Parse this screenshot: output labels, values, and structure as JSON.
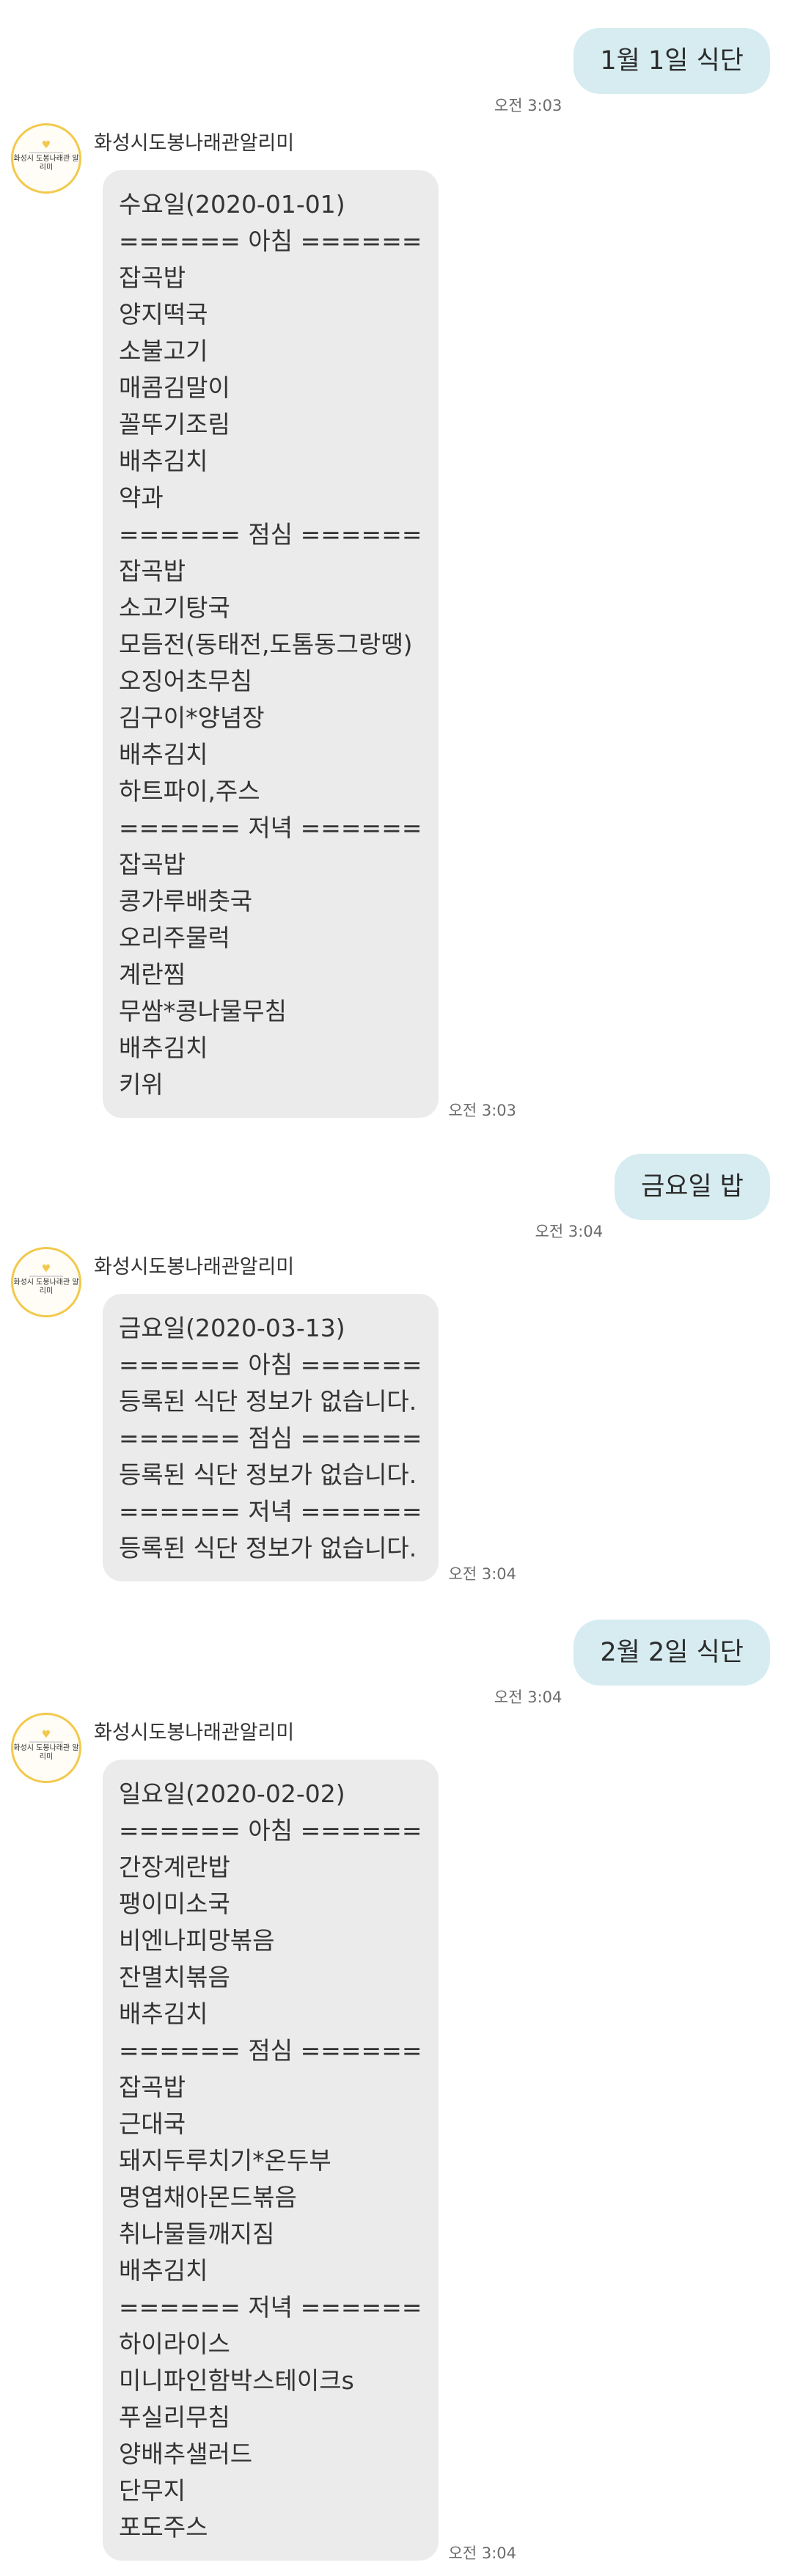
{
  "messages": [
    {
      "type": "out",
      "text": "1월 1일 식단",
      "time": "오전 3:03"
    },
    {
      "type": "in",
      "sender": "화성시도봉나래관알리미",
      "time": "오전 3:03",
      "lines": [
        "수요일(2020-01-01)",
        "====== 아침 ======",
        "잡곡밥",
        "양지떡국",
        "소불고기",
        "매콤김말이",
        "꼴뚜기조림",
        "배추김치",
        "약과",
        "====== 점심 ======",
        "잡곡밥",
        "소고기탕국",
        "모듬전(동태전,도톰동그랑땡)",
        "오징어초무침",
        "김구이*양념장",
        "배추김치",
        "하트파이,주스",
        "====== 저녁 ======",
        "잡곡밥",
        "콩가루배춧국",
        "오리주물럭",
        "계란찜",
        "무쌈*콩나물무침",
        "배추김치",
        "키위"
      ]
    },
    {
      "type": "out",
      "text": "금요일 밥",
      "time": "오전 3:04"
    },
    {
      "type": "in",
      "sender": "화성시도봉나래관알리미",
      "time": "오전 3:04",
      "lines": [
        "금요일(2020-03-13)",
        "====== 아침 ======",
        "등록된 식단 정보가 없습니다.",
        "====== 점심 ======",
        "등록된 식단 정보가 없습니다.",
        "====== 저녁 ======",
        "등록된 식단 정보가 없습니다."
      ]
    },
    {
      "type": "out",
      "text": "2월 2일 식단",
      "time": "오전 3:04"
    },
    {
      "type": "in",
      "sender": "화성시도봉나래관알리미",
      "time": "오전 3:04",
      "lines": [
        "일요일(2020-02-02)",
        "====== 아침 ======",
        "간장계란밥",
        "팽이미소국",
        "비엔나피망볶음",
        "잔멸치볶음",
        "배추김치",
        "====== 점심 ======",
        "잡곡밥",
        "근대국",
        "돼지두루치기*온두부",
        "명엽채아몬드볶음",
        "취나물들깨지짐",
        "배추김치",
        "====== 저녁 ======",
        "하이라이스",
        "미니파인함박스테이크s",
        "푸실리무침",
        "양배추샐러드",
        "단무지",
        "포도주스"
      ]
    }
  ],
  "avatar": {
    "logo_text": "화성시 도봉나래관 알리미",
    "accent": "#f2c94c"
  },
  "colors": {
    "out_bubble": "#d6ecf0",
    "in_bubble": "#ebebeb",
    "background": "#ffffff"
  }
}
